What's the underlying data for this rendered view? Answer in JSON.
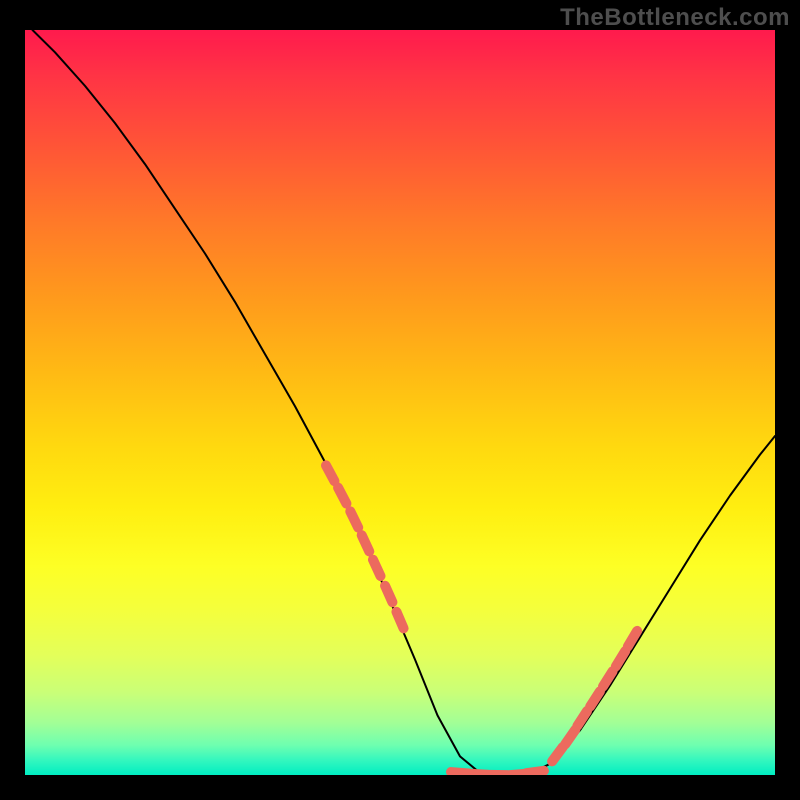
{
  "watermark": "TheBottleneck.com",
  "chart_data": {
    "type": "line",
    "title": "",
    "xlabel": "",
    "ylabel": "",
    "xlim": [
      0,
      100
    ],
    "ylim": [
      0,
      100
    ],
    "grid": false,
    "legend": false,
    "series": [
      {
        "name": "curve",
        "color": "#000000",
        "x": [
          1,
          4,
          8,
          12,
          16,
          20,
          24,
          28,
          32,
          36,
          40,
          44,
          48,
          52,
          55,
          58,
          61,
          64,
          67,
          70,
          74,
          78,
          82,
          86,
          90,
          94,
          98,
          100
        ],
        "y": [
          100,
          97,
          92.5,
          87.5,
          82,
          76,
          70,
          63.5,
          56.5,
          49.5,
          42,
          34,
          25,
          15.5,
          8,
          2.5,
          0,
          0,
          0,
          1.5,
          6,
          12,
          18.5,
          25,
          31.5,
          37.5,
          43,
          45.5
        ]
      },
      {
        "name": "left-dashes",
        "color": "#ec6a5e",
        "style": "thick-segments",
        "x": [
          40.7,
          42.3,
          43.9,
          45.4,
          46.9,
          48.5,
          50.0
        ],
        "y": [
          40.5,
          37.5,
          34.3,
          31.1,
          27.8,
          24.3,
          20.8
        ]
      },
      {
        "name": "right-dashes",
        "color": "#ec6a5e",
        "style": "thick-segments",
        "x": [
          71.0,
          72.7,
          74.3,
          76.0,
          77.7,
          79.4,
          81.0
        ],
        "y": [
          2.8,
          5.1,
          7.6,
          10.2,
          12.9,
          15.6,
          18.3
        ]
      },
      {
        "name": "bottom-dashes",
        "color": "#ec6a5e",
        "style": "thick-segments",
        "x": [
          58.0,
          60.5,
          63.0,
          65.5,
          68.0
        ],
        "y": [
          0.3,
          0.1,
          0.0,
          0.05,
          0.4
        ]
      }
    ],
    "gradient_stops": [
      {
        "pos": 0.0,
        "color": "#ff1a4d"
      },
      {
        "pos": 0.16,
        "color": "#ff5636"
      },
      {
        "pos": 0.36,
        "color": "#ff9a1c"
      },
      {
        "pos": 0.56,
        "color": "#ffd90f"
      },
      {
        "pos": 0.72,
        "color": "#fdff25"
      },
      {
        "pos": 0.89,
        "color": "#c9ff78"
      },
      {
        "pos": 1.0,
        "color": "#00eec2"
      }
    ]
  }
}
